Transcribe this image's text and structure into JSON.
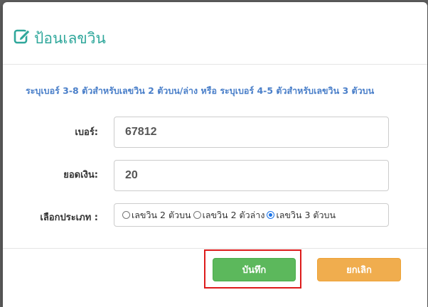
{
  "modal": {
    "title": "ป้อนเลขวิน",
    "title_icon": "edit-icon",
    "hint": "ระบุเบอร์ 3-8 ตัวสำหรับเลขวิน 2 ตัวบน/ล่าง หรือ ระบุเบอร์ 4-5 ตัวสำหรับเลขวิน 3 ตัวบน"
  },
  "form": {
    "number_label": "เบอร์:",
    "number_value": "67812",
    "amount_label": "ยอดเงิน:",
    "amount_value": "20",
    "type_label": "เลือกประเภท :",
    "type_options": [
      {
        "label": "เลขวิน 2 ตัวบน",
        "checked": false
      },
      {
        "label": "เลขวิน 2 ตัวล่าง",
        "checked": false
      },
      {
        "label": "เลขวิน 3 ตัวบน",
        "checked": true
      }
    ]
  },
  "footer": {
    "save_label": "บันทึก",
    "cancel_label": "ยกเลิก"
  },
  "colors": {
    "title": "#2fa79b",
    "hint": "#4a7fc9",
    "save": "#5cb85c",
    "cancel": "#f0ad4e",
    "highlight": "#dd1b1b"
  }
}
